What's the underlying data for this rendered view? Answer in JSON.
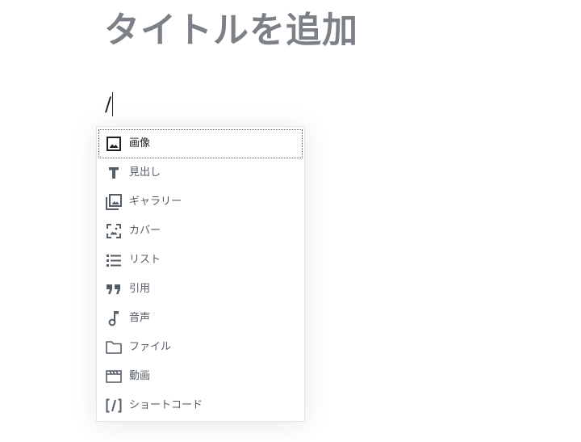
{
  "editor": {
    "title_placeholder": "タイトルを追加",
    "current_input": "/"
  },
  "inserter": {
    "selected_index": 0,
    "items": [
      {
        "label": "画像",
        "icon": "image-icon"
      },
      {
        "label": "見出し",
        "icon": "heading-icon"
      },
      {
        "label": "ギャラリー",
        "icon": "gallery-icon"
      },
      {
        "label": "カバー",
        "icon": "cover-icon"
      },
      {
        "label": "リスト",
        "icon": "list-icon"
      },
      {
        "label": "引用",
        "icon": "quote-icon"
      },
      {
        "label": "音声",
        "icon": "audio-icon"
      },
      {
        "label": "ファイル",
        "icon": "file-icon"
      },
      {
        "label": "動画",
        "icon": "video-icon"
      },
      {
        "label": "ショートコード",
        "icon": "shortcode-icon"
      }
    ]
  },
  "colors": {
    "title_placeholder": "#7b8187",
    "icon": "#555d66",
    "text": "#1e1e1e"
  }
}
